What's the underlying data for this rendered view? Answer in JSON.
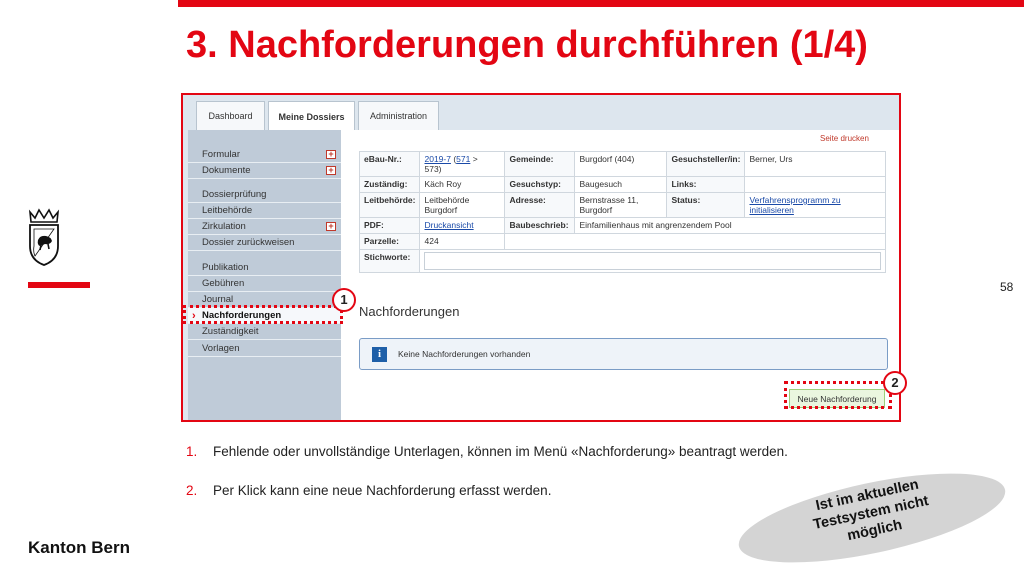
{
  "slide": {
    "title": "3. Nachforderungen durchführen (1/4)",
    "page_number": "58",
    "organization": "Kanton Bern",
    "accent_color": "#e30613"
  },
  "app": {
    "tabs": [
      {
        "label": "Dashboard"
      },
      {
        "label": "Meine Dossiers"
      },
      {
        "label": "Administration"
      }
    ],
    "sidebar": [
      {
        "label": "Formular",
        "expandable": true
      },
      {
        "label": "Dokumente",
        "expandable": true
      },
      {
        "label": "Dossierprüfung",
        "expandable": false
      },
      {
        "label": "Leitbehörde",
        "expandable": false
      },
      {
        "label": "Zirkulation",
        "expandable": true
      },
      {
        "label": "Dossier zurückweisen",
        "expandable": false
      },
      {
        "label": "Publikation",
        "expandable": false
      },
      {
        "label": "Gebühren",
        "expandable": false
      },
      {
        "label": "Journal",
        "expandable": false
      },
      {
        "label": "Nachforderungen",
        "expandable": false
      },
      {
        "label": "Zuständigkeit",
        "expandable": false
      },
      {
        "label": "Vorlagen",
        "expandable": false
      }
    ],
    "print_link": "Seite drucken",
    "info": {
      "ebau_label": "eBau-Nr.:",
      "ebau_link1": "2019-7",
      "ebau_link2": "571",
      "ebau_sep": ">",
      "ebau_rest": "573)",
      "gemeinde_label": "Gemeinde:",
      "gemeinde_value": "Burgdorf (404)",
      "gesuchsteller_label": "Gesuchsteller/in:",
      "gesuchsteller_value": "Berner, Urs",
      "zustaendig_label": "Zuständig:",
      "zustaendig_value": "Käch Roy",
      "gesuchstyp_label": "Gesuchstyp:",
      "gesuchstyp_value": "Baugesuch",
      "links_label": "Links:",
      "leitbehoerde_label": "Leitbehörde:",
      "leitbehoerde_value": "Leitbehörde Burgdorf",
      "adresse_label": "Adresse:",
      "adresse_value": "Bernstrasse 11, Burgdorf",
      "status_label": "Status:",
      "status_value": "Verfahrensprogramm zu initialisieren",
      "pdf_label": "PDF:",
      "pdf_value": "Druckansicht",
      "baubeschrieb_label": "Baubeschrieb:",
      "baubeschrieb_value": "Einfamilienhaus mit angrenzendem Pool",
      "parzelle_label": "Parzelle:",
      "parzelle_value": "424",
      "stichworte_label": "Stichworte:"
    },
    "section_title": "Nachforderungen",
    "info_message": "Keine Nachforderungen vorhanden",
    "new_button": "Neue Nachforderung"
  },
  "callouts": [
    "1",
    "2"
  ],
  "notes": [
    {
      "num": "1.",
      "text": "Fehlende oder unvollständige Unterlagen, können im Menü «Nachforderung» beantragt werden."
    },
    {
      "num": "2.",
      "text": "Per Klick kann eine neue Nachforderung erfasst werden."
    }
  ],
  "stamp": {
    "line1": "Ist im aktuellen",
    "line2": "Testsystem nicht",
    "line3": "möglich"
  }
}
